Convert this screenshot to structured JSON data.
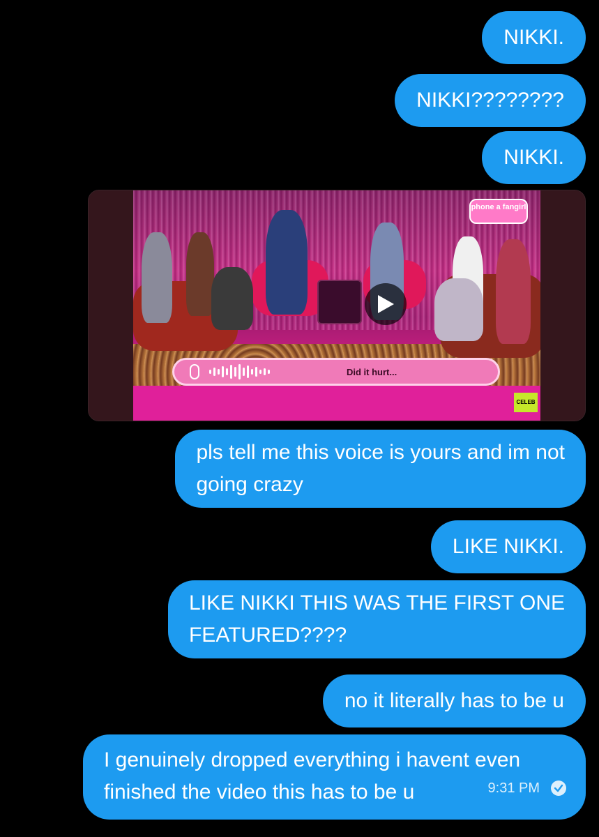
{
  "conversation": {
    "messages": [
      {
        "text": "NIKKI."
      },
      {
        "text": "NIKKI????????"
      },
      {
        "text": "NIKKI."
      },
      {
        "media": {
          "caption": "Did it hurt...",
          "logo_text": "phone a fangirl",
          "corner_badge": "CELEB"
        }
      },
      {
        "lines": [
          "pls tell me this voice is yours and im not",
          "going crazy"
        ]
      },
      {
        "text": "LIKE NIKKI."
      },
      {
        "lines": [
          "LIKE NIKKI THIS WAS THE FIRST ONE",
          "FEATURED????"
        ]
      },
      {
        "text": "no it literally has to be u"
      },
      {
        "lines": [
          "I genuinely dropped everything i havent even",
          "finished the video this has to be u"
        ],
        "timestamp": "9:31 PM",
        "status_icon": "read-check-icon"
      }
    ]
  },
  "colors": {
    "background": "#000000",
    "bubble": "#1d9bf0",
    "text": "#ffffff"
  }
}
